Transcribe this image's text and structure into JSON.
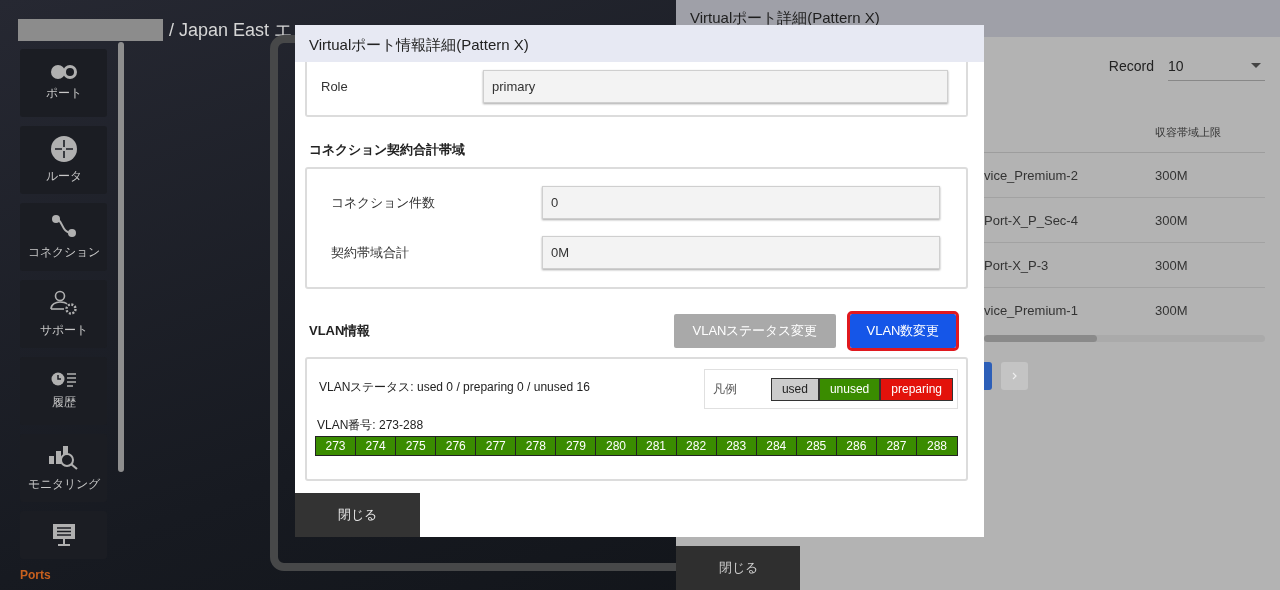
{
  "header": {
    "breadcrumb": "/ Japan East エ"
  },
  "sidebar": {
    "items": [
      {
        "label": "ポート"
      },
      {
        "label": "ルータ"
      },
      {
        "label": "コネクション"
      },
      {
        "label": "サポート"
      },
      {
        "label": "履歴"
      },
      {
        "label": "モニタリング"
      }
    ],
    "partial_item": true,
    "footer": "Ports"
  },
  "back_dialog": {
    "title": "Virtualポート詳細(Pattern X)",
    "record_label": "Record",
    "record_value": "10",
    "column_header": "収容帯域上限",
    "rows": [
      {
        "name": "vice_Premium-2",
        "bandwidth": "300M"
      },
      {
        "name": "Port-X_P_Sec-4",
        "bandwidth": "300M"
      },
      {
        "name": "Port-X_P-3",
        "bandwidth": "300M"
      },
      {
        "name": "vice_Premium-1",
        "bandwidth": "300M"
      }
    ],
    "close_button": "閉じる"
  },
  "dialog": {
    "title": "Virtualポート情報詳細(Pattern X)",
    "role": {
      "label": "Role",
      "value": "primary"
    },
    "connection_section": {
      "title": "コネクション契約合計帯域",
      "fields": [
        {
          "label": "コネクション件数",
          "value": "0"
        },
        {
          "label": "契約帯域合計",
          "value": "0M"
        }
      ]
    },
    "vlan": {
      "title": "VLAN情報",
      "buttons": [
        {
          "label": "VLANステータス変更",
          "disabled": true,
          "focused": false
        },
        {
          "label": "VLAN数変更",
          "disabled": false,
          "focused": true
        }
      ],
      "status_text": "VLANステータス: used 0 / preparing 0 / unused 16",
      "legend": {
        "label": "凡例",
        "items": [
          {
            "label": "used",
            "color": "#cccccc"
          },
          {
            "label": "unused",
            "color": "#3a8c00"
          },
          {
            "label": "preparing",
            "color": "#e3120b"
          }
        ]
      },
      "numbers_label": "VLAN番号: 273-288",
      "vlans": [
        {
          "number": "273",
          "color": "#3a8c00"
        },
        {
          "number": "274",
          "color": "#3a8c00"
        },
        {
          "number": "275",
          "color": "#3a8c00"
        },
        {
          "number": "276",
          "color": "#3a8c00"
        },
        {
          "number": "277",
          "color": "#3a8c00"
        },
        {
          "number": "278",
          "color": "#3a8c00"
        },
        {
          "number": "279",
          "color": "#3a8c00"
        },
        {
          "number": "280",
          "color": "#3a8c00"
        },
        {
          "number": "281",
          "color": "#3a8c00"
        },
        {
          "number": "282",
          "color": "#3a8c00"
        },
        {
          "number": "283",
          "color": "#3a8c00"
        },
        {
          "number": "284",
          "color": "#3a8c00"
        },
        {
          "number": "285",
          "color": "#3a8c00"
        },
        {
          "number": "286",
          "color": "#3a8c00"
        },
        {
          "number": "287",
          "color": "#3a8c00"
        },
        {
          "number": "288",
          "color": "#3a8c00"
        }
      ]
    },
    "close_button": "閉じる"
  }
}
